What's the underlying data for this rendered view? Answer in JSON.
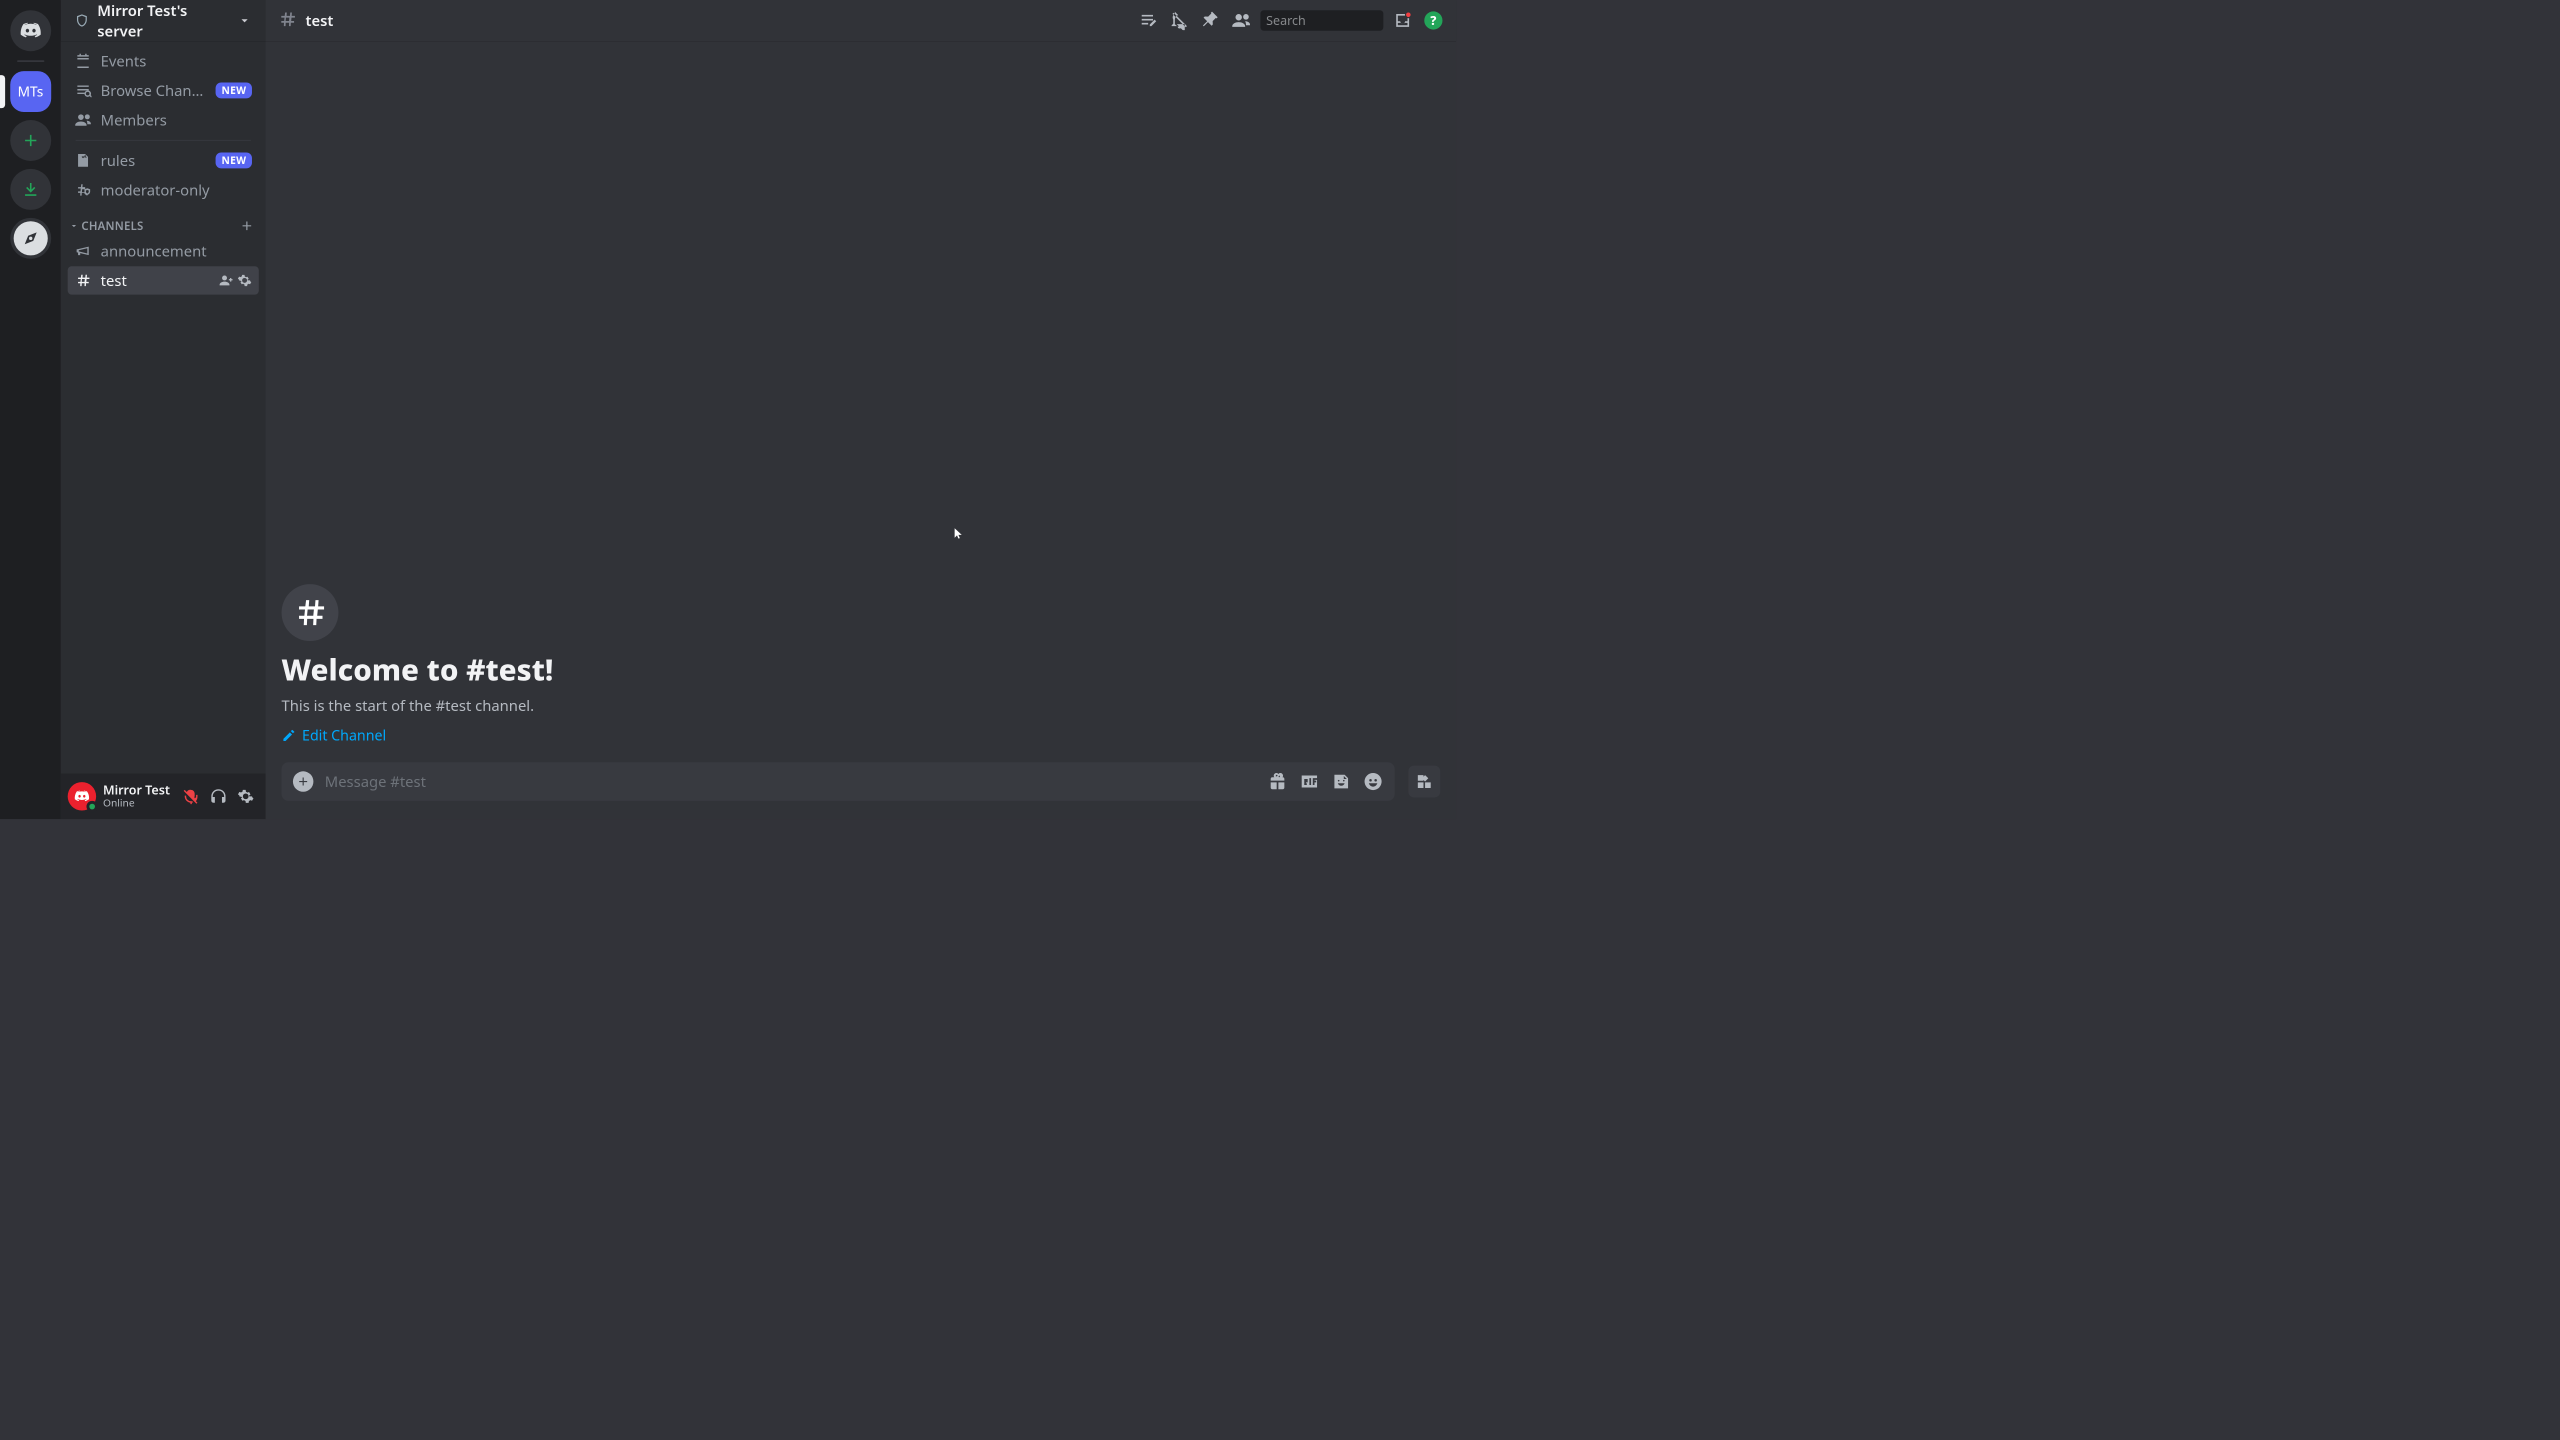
{
  "server": {
    "name": "Mirror Test's server",
    "initials": "MTs"
  },
  "sidebar": {
    "events": "Events",
    "browse": "Browse Channels",
    "members": "Members",
    "new_badge": "NEW",
    "rules": "rules",
    "moderator_only": "moderator-only",
    "category_channels": "CHANNELS",
    "announcement": "announcement",
    "test": "test"
  },
  "user": {
    "name": "Mirror Test",
    "status": "Online"
  },
  "header": {
    "channel": "test",
    "search_placeholder": "Search"
  },
  "welcome": {
    "title": "Welcome to #test!",
    "subtitle": "This is the start of the #test channel.",
    "edit": "Edit Channel"
  },
  "composer": {
    "placeholder": "Message #test"
  }
}
